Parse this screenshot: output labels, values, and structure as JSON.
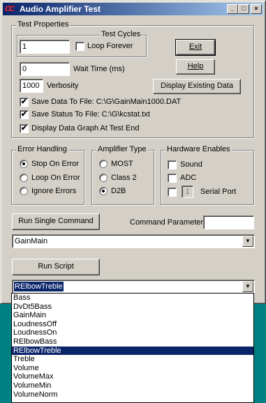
{
  "window": {
    "icon_text": "CC",
    "title": "Audio Amplifier Test",
    "minimize_glyph": "_",
    "maximize_glyph": "□",
    "close_glyph": "×"
  },
  "test_properties": {
    "legend": "Test Properties",
    "test_cycles_legend": "Test Cycles",
    "cycles_value": "1",
    "loop_forever_label": "Loop Forever",
    "loop_forever_checked": false,
    "wait_time_value": "0",
    "wait_time_label": "Wait Time (ms)",
    "verbosity_value": "1000",
    "verbosity_label": "Verbosity",
    "exit_label": "Exit",
    "help_label": "Help",
    "display_data_label": "Display Existing Data",
    "save_data_label": "Save Data To File: C:\\G\\GainMain1000.DAT",
    "save_data_checked": true,
    "save_status_label": "Save Status To File: C:\\G\\kcstat.txt",
    "save_status_checked": true,
    "display_graph_label": "Display Data Graph At Test End",
    "display_graph_checked": true
  },
  "error_handling": {
    "legend": "Error Handling",
    "options": [
      "Stop On Error",
      "Loop On Error",
      "Ignore Errors"
    ],
    "selected": "Stop On Error"
  },
  "amplifier_type": {
    "legend": "Amplifier Type",
    "options": [
      "MOST",
      "Class 2",
      "D2B"
    ],
    "selected": "D2B"
  },
  "hardware_enables": {
    "legend": "Hardware Enables",
    "sound_label": "Sound",
    "sound_checked": false,
    "adc_label": "ADC",
    "adc_checked": false,
    "serial_port_label": "Serial Port",
    "serial_port_checked": false,
    "serial_port_value": "1"
  },
  "command": {
    "run_single_label": "Run Single Command",
    "parameter_label": "Command Parameter",
    "parameter_value": "",
    "selected_command": "GainMain"
  },
  "script": {
    "run_script_label": "Run Script",
    "selected_script": "RElbowTreble",
    "options": [
      "Bass",
      "DvDt5Bass",
      "GainMain",
      "LoudnessOff",
      "LoudnessOn",
      "RElbowBass",
      "RElbowTreble",
      "Treble",
      "Volume",
      "VolumeMax",
      "VolumeMin",
      "VolumeNorm"
    ]
  },
  "icons": {
    "checkmark": "✔",
    "dropdown_arrow": "▼"
  }
}
